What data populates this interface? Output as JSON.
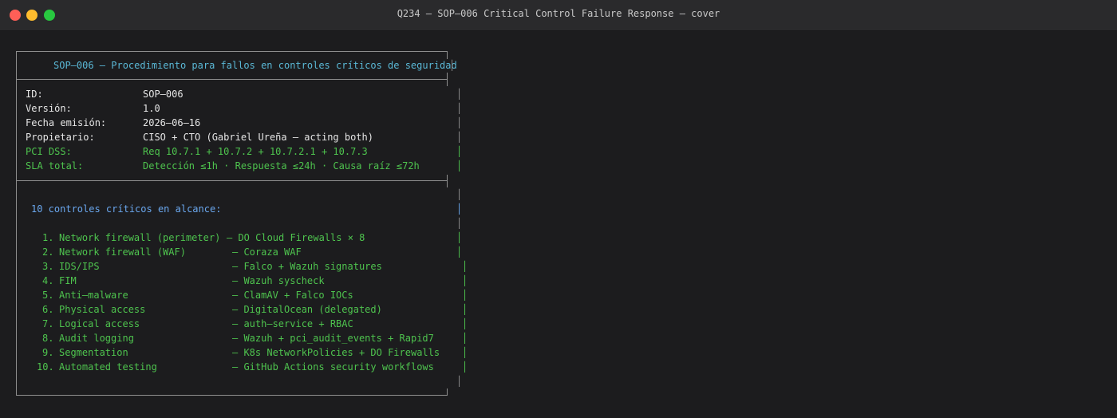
{
  "window": {
    "title": "Q234 — SOP–006 Critical Control Failure Response — cover"
  },
  "header": {
    "title": "SOP–006 — Procedimiento para fallos en controles críticos de seguridad"
  },
  "meta": [
    {
      "label": "ID:",
      "value": "SOP–006",
      "color": "white"
    },
    {
      "label": "Versión:",
      "value": "1.0",
      "color": "white"
    },
    {
      "label": "Fecha emisión:",
      "value": "2026–06–16",
      "color": "white"
    },
    {
      "label": "Propietario:",
      "value": "CISO + CTO (Gabriel Ureña — acting both)",
      "color": "white"
    },
    {
      "label": "PCI DSS:",
      "value": "Req 10.7.1 + 10.7.2 + 10.7.2.1 + 10.7.3",
      "color": "green"
    },
    {
      "label": "SLA total:",
      "value": "Detección ≤1h · Respuesta ≤24h · Causa raíz ≤72h",
      "color": "green"
    }
  ],
  "controls": {
    "heading": "10 controles críticos en alcance:",
    "items": [
      {
        "num": "1.",
        "name": "Network firewall (perimeter)",
        "impl": "— DO Cloud Firewalls × 8"
      },
      {
        "num": "2.",
        "name": "Network firewall (WAF)",
        "impl": "— Coraza WAF"
      },
      {
        "num": "3.",
        "name": "IDS/IPS",
        "impl": "— Falco + Wazuh signatures"
      },
      {
        "num": "4.",
        "name": "FIM",
        "impl": "— Wazuh syscheck"
      },
      {
        "num": "5.",
        "name": "Anti–malware",
        "impl": "— ClamAV + Falco IOCs"
      },
      {
        "num": "6.",
        "name": "Physical access",
        "impl": "— DigitalOcean (delegated)"
      },
      {
        "num": "7.",
        "name": "Logical access",
        "impl": "— auth–service + RBAC"
      },
      {
        "num": "8.",
        "name": "Audit logging",
        "impl": "— Wazuh + pci_audit_events + Rapid7"
      },
      {
        "num": "9.",
        "name": "Segmentation",
        "impl": "— K8s NetworkPolicies + DO Firewalls"
      },
      {
        "num": "10.",
        "name": "Automated testing",
        "impl": "— GitHub Actions security workflows"
      }
    ]
  },
  "colors": {
    "background": "#1c1c1e",
    "green": "#4ec34e",
    "cyan": "#5ab8d6",
    "blue": "#6aa7ee",
    "white": "#e6e6e6",
    "border": "#8e8e8e"
  }
}
